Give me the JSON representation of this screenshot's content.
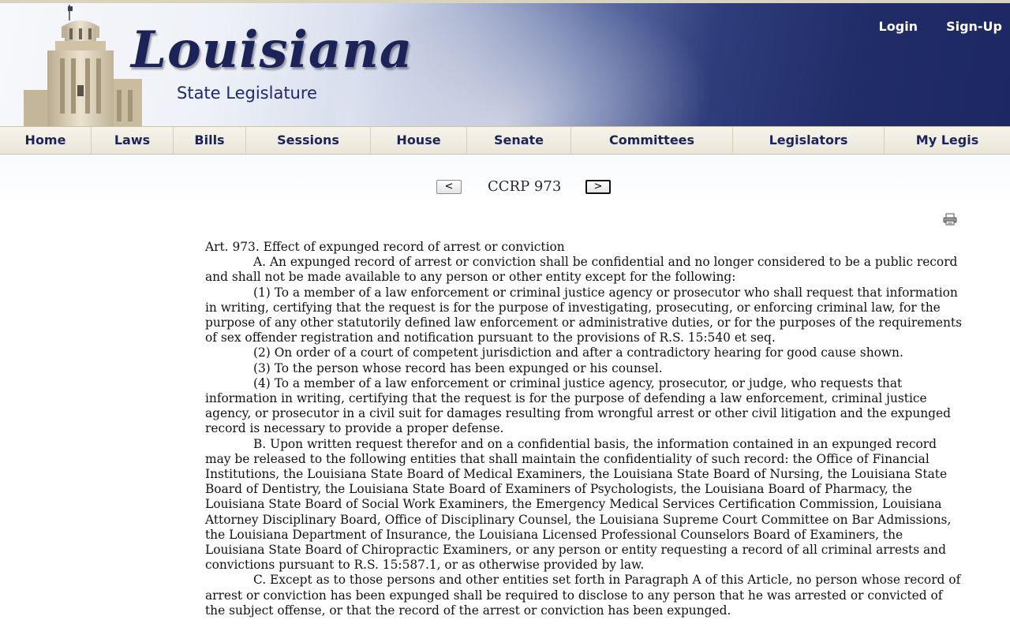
{
  "header": {
    "logo_title": "Louisiana",
    "logo_subtitle": "State Legislature",
    "login_label": "Login",
    "signup_label": "Sign-Up"
  },
  "nav": {
    "items": [
      {
        "label": "Home"
      },
      {
        "label": "Laws"
      },
      {
        "label": "Bills"
      },
      {
        "label": "Sessions"
      },
      {
        "label": "House"
      },
      {
        "label": "Senate"
      },
      {
        "label": "Committees"
      },
      {
        "label": "Legislators"
      },
      {
        "label": "My Legis"
      }
    ]
  },
  "pager": {
    "prev_label": "<",
    "title": "CCRP 973",
    "next_label": ">"
  },
  "icons": {
    "print": "print-icon"
  },
  "document": {
    "heading": "Art. 973. Effect of expunged record of arrest or conviction",
    "paragraphs": [
      "A. An expunged record of arrest or conviction shall be confidential and no longer considered to be a public record and shall not be made available to any person or other entity except for the following:",
      "(1) To a member of a law enforcement or criminal justice agency or prosecutor who shall request that information in writing, certifying that the request is for the purpose of investigating, prosecuting, or enforcing criminal law, for the purpose of any other statutorily defined law enforcement or administrative duties, or for the purposes of the requirements of sex offender registration and notification pursuant to the provisions of R.S. 15:540 et seq.",
      "(2) On order of a court of competent jurisdiction and after a contradictory hearing for good cause shown.",
      "(3) To the person whose record has been expunged or his counsel.",
      "(4) To a member of a law enforcement or criminal justice agency, prosecutor, or judge, who requests that information in writing, certifying that the request is for the purpose of defending a law enforcement, criminal justice agency, or prosecutor in a civil suit for damages resulting from wrongful arrest or other civil litigation and the expunged record is necessary to provide a proper defense.",
      "B. Upon written request therefor and on a confidential basis, the information contained in an expunged record may be released to the following entities that shall maintain the confidentiality of such record: the Office of Financial Institutions, the Louisiana State Board of Medical Examiners, the Louisiana State Board of Nursing, the Louisiana State Board of Dentistry, the Louisiana State Board of Examiners of Psychologists, the Louisiana Board of Pharmacy, the Louisiana State Board of Social Work Examiners, the Emergency Medical Services Certification Commission, Louisiana Attorney Disciplinary Board, Office of Disciplinary Counsel, the Louisiana Supreme Court Committee on Bar Admissions, the Louisiana Department of Insurance, the Louisiana Licensed Professional Counselors Board of Examiners, the Louisiana State Board of Chiropractic Examiners, or any person or entity requesting a record of all criminal arrests and convictions pursuant to R.S. 15:587.1, or as otherwise provided by law.",
      "C. Except as to those persons and other entities set forth in Paragraph A of this Article, no person whose record of arrest or conviction has been expunged shall be required to disclose to any person that he was arrested or convicted of the subject offense, or that the record of the arrest or conviction has been expunged."
    ]
  }
}
